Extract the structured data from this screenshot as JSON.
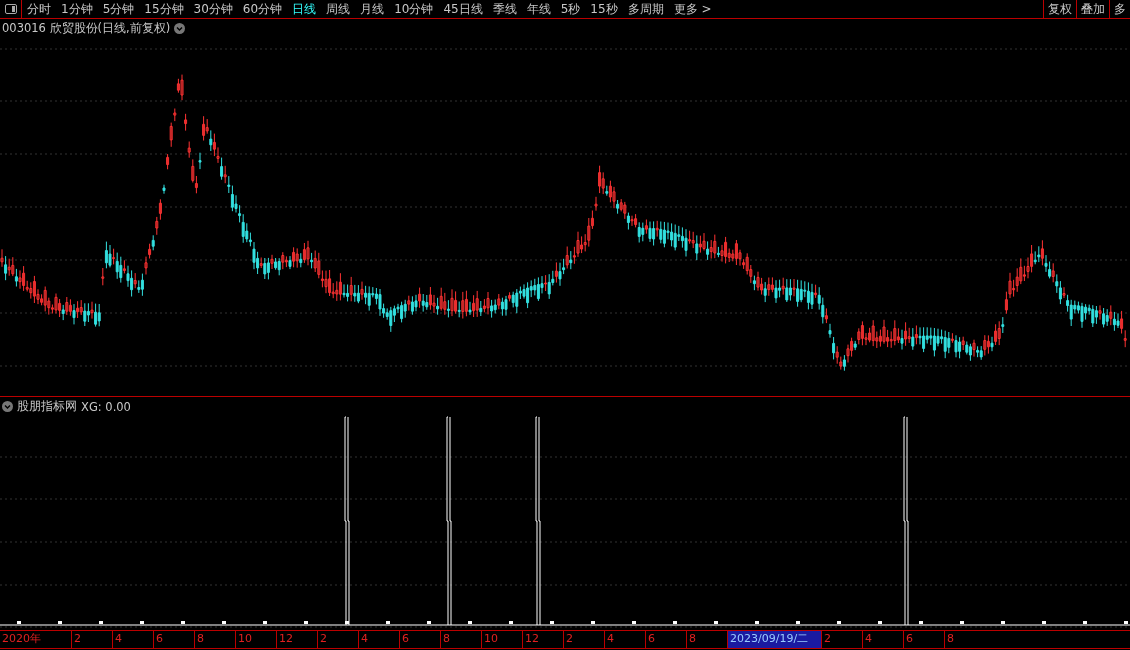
{
  "toolbar": {
    "tabs": [
      {
        "label": "分时",
        "selected": false
      },
      {
        "label": "1分钟",
        "selected": false
      },
      {
        "label": "5分钟",
        "selected": false
      },
      {
        "label": "15分钟",
        "selected": false
      },
      {
        "label": "30分钟",
        "selected": false
      },
      {
        "label": "60分钟",
        "selected": false
      },
      {
        "label": "日线",
        "selected": true
      },
      {
        "label": "周线",
        "selected": false
      },
      {
        "label": "月线",
        "selected": false
      },
      {
        "label": "10分钟",
        "selected": false
      },
      {
        "label": "45日线",
        "selected": false
      },
      {
        "label": "季线",
        "selected": false
      },
      {
        "label": "年线",
        "selected": false
      },
      {
        "label": "5秒",
        "selected": false
      },
      {
        "label": "15秒",
        "selected": false
      },
      {
        "label": "多周期",
        "selected": false
      },
      {
        "label": "更多 >",
        "selected": false
      }
    ],
    "right_buttons": [
      "复权",
      "叠加",
      "多"
    ]
  },
  "main_chart": {
    "title": "003016 欣贸股份(日线,前复权)"
  },
  "indicator": {
    "name": "股朋指标网",
    "value": "XG: 0.00"
  },
  "time_axis": [
    {
      "label": "2020年",
      "selected": false
    },
    {
      "label": "2",
      "selected": false
    },
    {
      "label": "4",
      "selected": false
    },
    {
      "label": "6",
      "selected": false
    },
    {
      "label": "8",
      "selected": false
    },
    {
      "label": "10",
      "selected": false
    },
    {
      "label": "12",
      "selected": false
    },
    {
      "label": "2",
      "selected": false
    },
    {
      "label": "4",
      "selected": false
    },
    {
      "label": "6",
      "selected": false
    },
    {
      "label": "8",
      "selected": false
    },
    {
      "label": "10",
      "selected": false
    },
    {
      "label": "12",
      "selected": false
    },
    {
      "label": "2",
      "selected": false
    },
    {
      "label": "4",
      "selected": false
    },
    {
      "label": "6",
      "selected": false
    },
    {
      "label": "8",
      "selected": false
    },
    {
      "label": "2023/09/19/二",
      "selected": true
    },
    {
      "label": "2",
      "selected": false
    },
    {
      "label": "4",
      "selected": false
    },
    {
      "label": "6",
      "selected": false
    },
    {
      "label": "8",
      "selected": false
    }
  ]
}
